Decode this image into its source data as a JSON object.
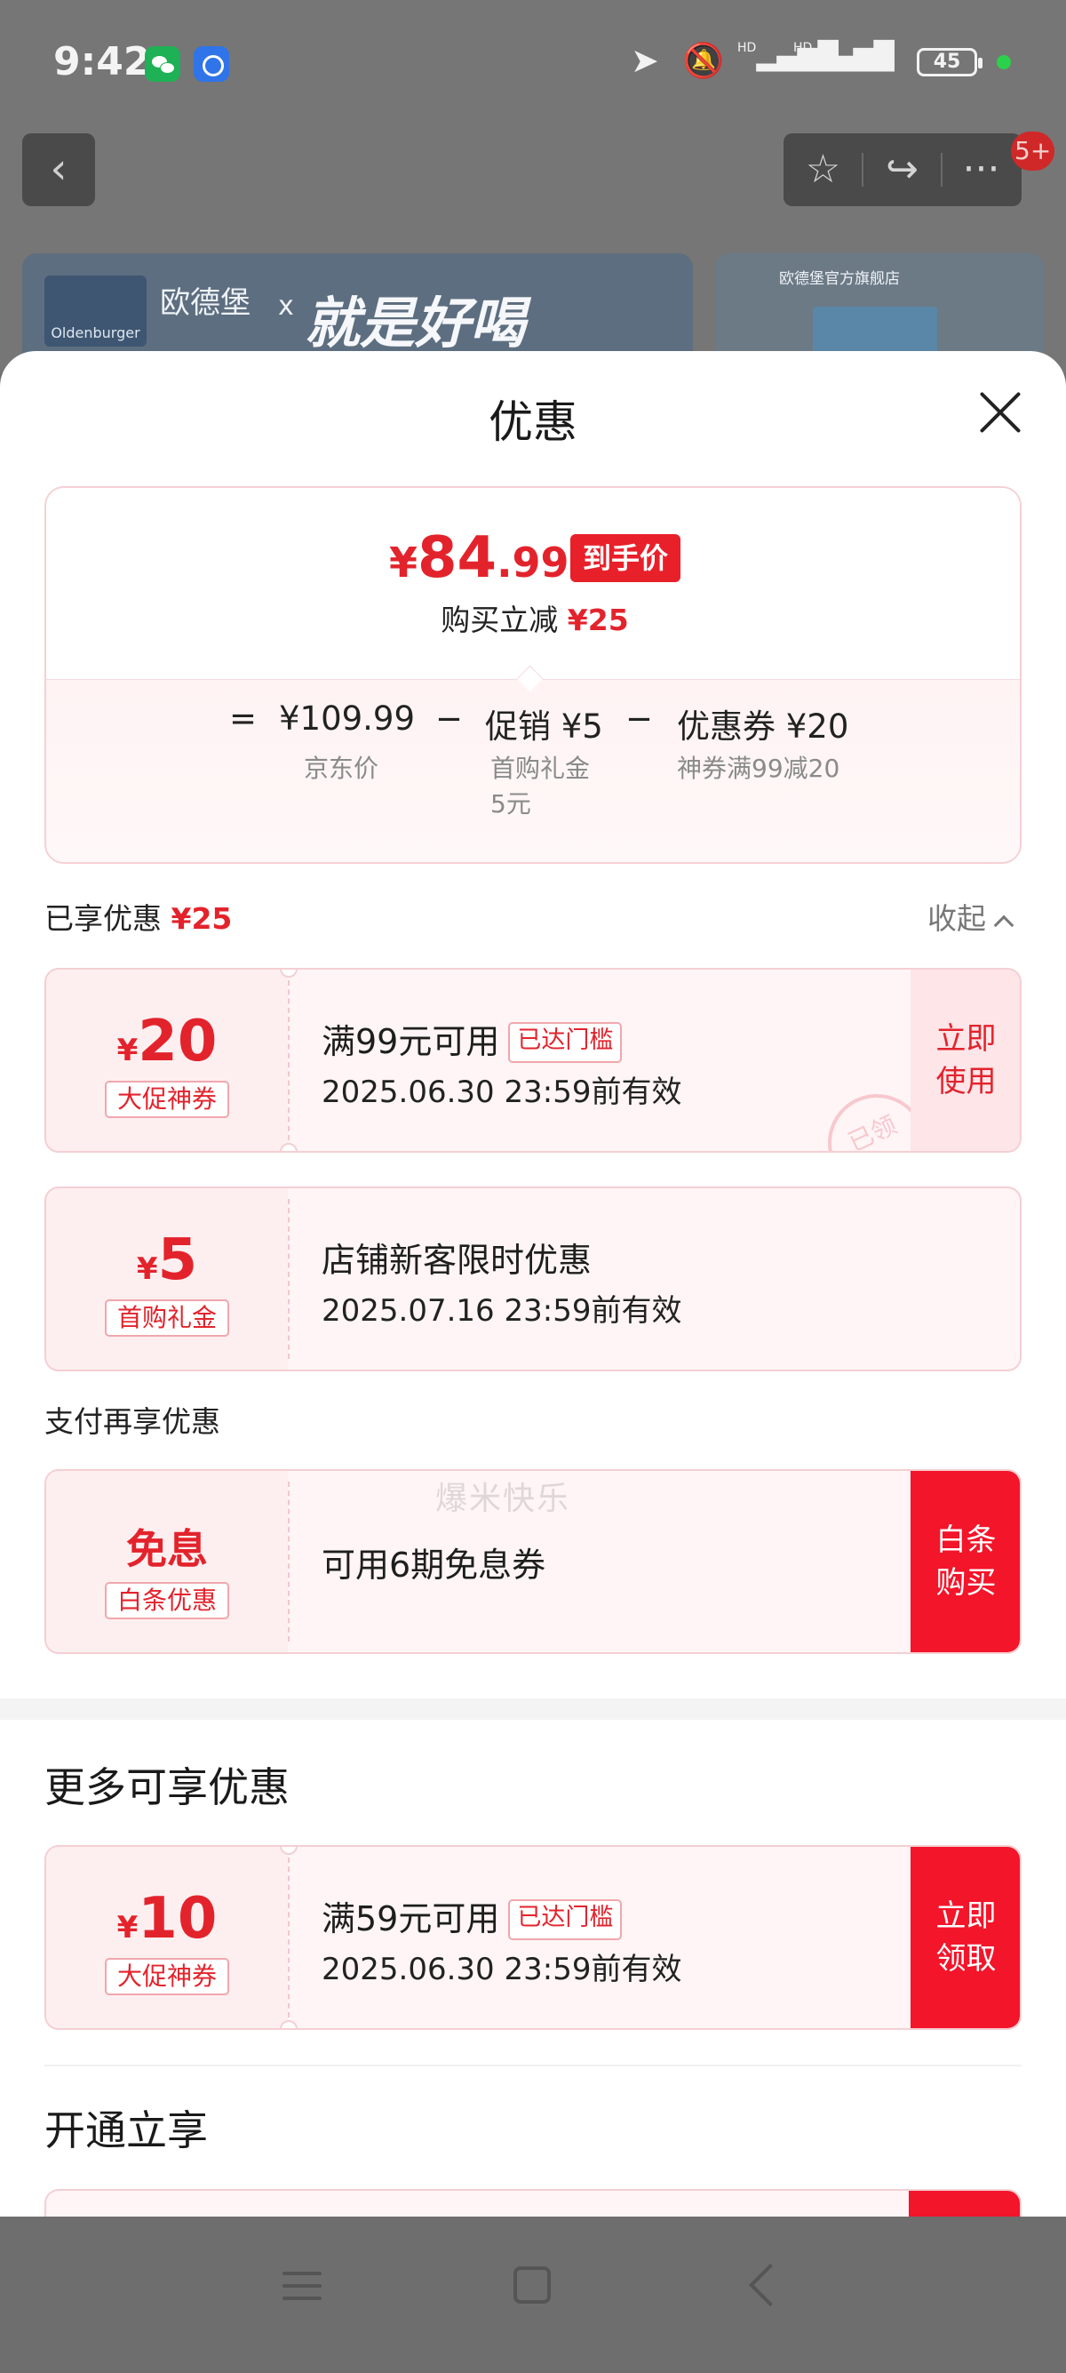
{
  "status_bar": {
    "time": "9:42",
    "app_icons": [
      "wechat-icon",
      "alarm-app-icon"
    ],
    "right_icons": [
      "navigation-icon",
      "mute-icon",
      "signal-hd-icon",
      "signal-hd-icon",
      "wifi-icon"
    ],
    "signal_label_1": "HD",
    "signal_label_2": "HD",
    "battery": "45",
    "dot_color": "#2bd14a"
  },
  "top_bar": {
    "back_glyph": "‹",
    "favorite_glyph": "☆",
    "share_glyph": "↪",
    "more_glyph": "···",
    "badge": "5+"
  },
  "banner": {
    "logo_text": "Oldenburger",
    "brand": "欧德堡",
    "x": "x",
    "slogan": "就是好喝",
    "store": "欧德堡官方旗舰店"
  },
  "sheet": {
    "title": "优惠",
    "price_card": {
      "currency": "¥",
      "price_int": "84",
      "price_dec": ".99",
      "price_tag": "到手价",
      "reduce_label": "购买立减",
      "reduce_amount": "¥25",
      "formula": [
        {
          "op": "=",
          "value": "¥109.99",
          "caption": "京东价"
        },
        {
          "op": "−",
          "value": "促销 ¥5",
          "caption": "首购礼金\n5元"
        },
        {
          "op": "−",
          "value": "优惠券 ¥20",
          "caption": "神券满99减20"
        }
      ]
    },
    "enjoyed": {
      "label": "已享优惠",
      "amount": "¥25",
      "collapse": "收起"
    },
    "coupons_enjoyed": [
      {
        "currency": "¥",
        "amount": "20",
        "tag": "大促神券",
        "title": "满99元可用",
        "badge": "已达门槛",
        "date": "2025.06.30 23:59前有效",
        "action_line1": "立即",
        "action_line2": "使用",
        "stamp": "已领"
      },
      {
        "currency": "¥",
        "amount": "5",
        "tag": "首购礼金",
        "title": "店铺新客限时优惠",
        "date": "2025.07.16 23:59前有效"
      }
    ],
    "pay_section": {
      "label": "支付再享优惠",
      "coupon": {
        "amount_text": "免息",
        "tag": "白条优惠",
        "title": "可用6期免息券",
        "action_line1": "白条",
        "action_line2": "购买"
      }
    },
    "more_section": {
      "heading": "更多可享优惠",
      "coupon": {
        "currency": "¥",
        "amount": "10",
        "tag": "大促神券",
        "title": "满59元可用",
        "badge": "已达门槛",
        "date": "2025.06.30 23:59前有效",
        "action_line1": "立即",
        "action_line2": "领取"
      }
    },
    "open_section": {
      "heading": "开通立享"
    },
    "watermark": "爆米快乐"
  },
  "colors": {
    "accent_red": "#e3232c",
    "button_red": "#f3152a",
    "coupon_bg": "#fff5f6"
  }
}
